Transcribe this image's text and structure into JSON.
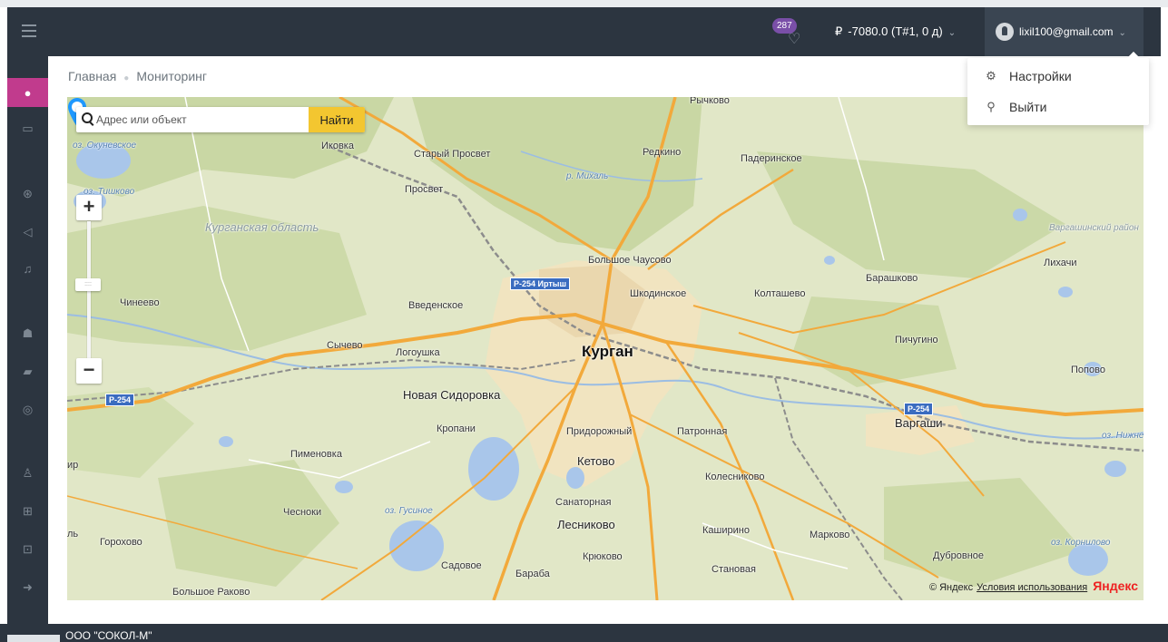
{
  "header": {
    "notifications_count": "287",
    "balance": "-7080.0 (Т#1, 0 д)",
    "currency_symbol": "₽",
    "user_email": "lixil100@gmail.com"
  },
  "sidebar": {
    "items": [
      {
        "icon": "globe-icon",
        "glyph": "●",
        "active": true
      },
      {
        "icon": "monitor-icon",
        "glyph": "▭",
        "active": false
      },
      {
        "icon": "dashboard-icon",
        "glyph": "⊛",
        "active": false
      },
      {
        "icon": "send-icon",
        "glyph": "◁",
        "active": false
      },
      {
        "icon": "bell-icon",
        "glyph": "♫",
        "active": false
      },
      {
        "icon": "users-icon",
        "glyph": "☗",
        "active": false
      },
      {
        "icon": "book-icon",
        "glyph": "▰",
        "active": false
      },
      {
        "icon": "chat-icon",
        "glyph": "◎",
        "active": false
      },
      {
        "icon": "user-icon",
        "glyph": "♙",
        "active": false
      },
      {
        "icon": "grid-icon",
        "glyph": "⊞",
        "active": false
      },
      {
        "icon": "money-icon",
        "glyph": "⊡",
        "active": false
      },
      {
        "icon": "arrow-circle-icon",
        "glyph": "➜",
        "active": false
      }
    ]
  },
  "breadcrumb": {
    "home": "Главная",
    "current": "Мониторинг"
  },
  "map": {
    "search_placeholder": "Адрес или объект",
    "search_button": "Найти",
    "zoom_in": "+",
    "zoom_out": "−",
    "attribution": "© Яндекс",
    "terms": "Условия использования",
    "logo": "Яндекс",
    "labels": {
      "rychkovo": "Рычково",
      "ozero_okunevskoe": "оз. Окуневское",
      "ikovka": "Иковка",
      "stary_prosvet": "Старый Просвет",
      "redkino": "Редкино",
      "paderinskoe": "Падеринское",
      "r_mikhal": "р. Михаль",
      "ozero_tishkovo": "оз. Тишково",
      "prosvet": "Просвет",
      "kurganskaya_oblast": "Курганская область",
      "vargashinsky_rayon": "Варгашинский район",
      "bolshoe_chausovo": "Большое Чаусово",
      "barashkovo": "Барашково",
      "likhachi": "Лихачи",
      "chineevo": "Чинеево",
      "vvedenskoe": "Введенское",
      "shkodinskoe": "Шкодинское",
      "koltashevo": "Колташево",
      "pichugino": "Пичугино",
      "sychevo": "Сычево",
      "logoushka": "Логоушка",
      "kurgan": "Курган",
      "popovo": "Попово",
      "novaya_sidorovka": "Новая Сидоровка",
      "vargashi": "Варгаши",
      "kropani": "Кропани",
      "pridorozhny": "Придорожный",
      "patronnaya": "Патронная",
      "ozero_nizhnee": "оз. Нижне",
      "pimenovka": "Пименовка",
      "ketovo": "Кетово",
      "kolesnikovo": "Колесниково",
      "rp": "ир",
      "sanatornaya": "Санаторная",
      "chesnoki": "Чесноки",
      "ozero_gusinoe": "оз. Гусиное",
      "lesnikovo": "Лесниково",
      "kashirino": "Каширино",
      "markovo": "Марково",
      "l": "ль",
      "gorokhovo": "Горохово",
      "dubrovnoe": "Дубровное",
      "ozero_kornilovo": "оз. Корнилово",
      "kryukovo": "Крюково",
      "sadovoe": "Садовое",
      "baraba": "Бараба",
      "stanovaya": "Становая",
      "bolshoe_rakovo": "Большое Раково"
    },
    "shields": {
      "r254_irtysh": "Р-254 Иртыш",
      "r254_west": "Р-254",
      "r254_east": "Р-254"
    }
  },
  "dropdown": {
    "settings": "Настройки",
    "logout": "Выйти"
  },
  "footer": {
    "company": "ООО \"СОКОЛ-М\""
  },
  "colors": {
    "header_bg": "#2c3540",
    "sidebar_active": "#c13b8d",
    "badge": "#7a4fa8",
    "search_button": "#f3c630",
    "road_main": "#f2a93b",
    "map_background": "#e1e7c7"
  }
}
